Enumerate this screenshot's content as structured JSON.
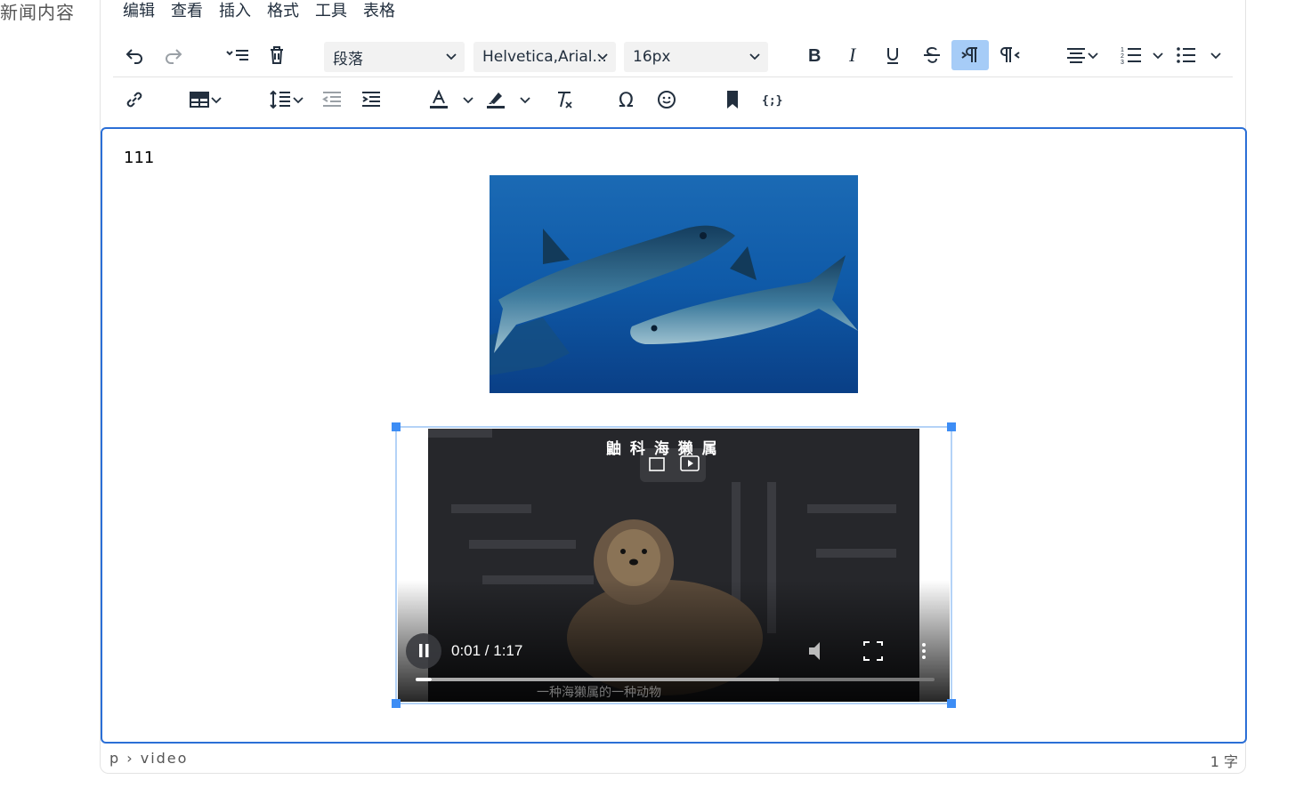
{
  "field_label": "新闻内容",
  "menubar": [
    "编辑",
    "查看",
    "插入",
    "格式",
    "工具",
    "表格"
  ],
  "toolbar": {
    "block_format": "段落",
    "font_family": "Helvetica,Arial...",
    "font_size": "16px"
  },
  "icons": {
    "row1": [
      "undo-icon",
      "redo-icon",
      "remove-format-list-icon",
      "delete-icon",
      "bold-icon",
      "italic-icon",
      "underline-icon",
      "strikethrough-icon",
      "ltr-icon",
      "rtl-icon",
      "align-icon",
      "numbered-list-icon",
      "bullet-list-icon"
    ],
    "row2": [
      "link-icon",
      "table-icon",
      "line-height-icon",
      "outdent-icon",
      "indent-icon",
      "text-color-icon",
      "highlight-icon",
      "clear-formatting-icon",
      "special-char-icon",
      "emoji-icon",
      "bookmark-icon",
      "code-icon"
    ]
  },
  "content": {
    "paragraph": "111",
    "image_alt": "tuna fish underwater",
    "video": {
      "title_overlay": "鼬 科 海 獭 属",
      "time": "0:01 / 1:17",
      "progress": 0.71,
      "caption": "一种海獭属的一种动物"
    }
  },
  "statusbar": {
    "path": "p › video",
    "word_count": "1 字"
  },
  "colors": {
    "accent": "#2b6fd6",
    "handle": "#3d8df5",
    "active_button": "#a6ccf7"
  }
}
